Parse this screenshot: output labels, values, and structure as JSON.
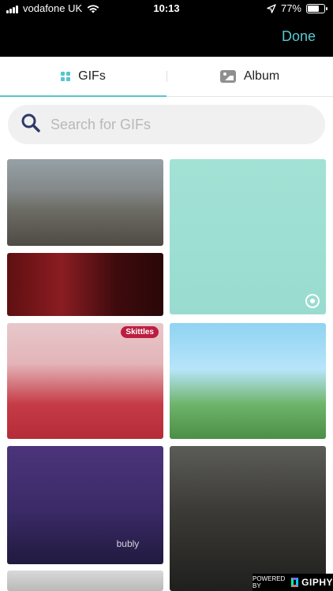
{
  "status_bar": {
    "carrier": "vodafone UK",
    "time": "10:13",
    "battery": "77%",
    "battery_level": 0.77
  },
  "header": {
    "done_label": "Done"
  },
  "tabs": [
    {
      "label": "GIFs",
      "active": true,
      "icon": "grid-icon"
    },
    {
      "label": "Album",
      "active": false,
      "icon": "photo-icon"
    }
  ],
  "search": {
    "placeholder": "Search for GIFs",
    "value": ""
  },
  "gifs": [
    {
      "id": "gif-1"
    },
    {
      "id": "gif-2"
    },
    {
      "id": "gif-3"
    },
    {
      "id": "gif-4",
      "brand": "Skittles"
    },
    {
      "id": "gif-5"
    },
    {
      "id": "gif-6",
      "brand": "bubly"
    },
    {
      "id": "gif-7"
    },
    {
      "id": "gif-8"
    }
  ],
  "footer": {
    "powered_by": "POWERED BY",
    "brand": "GIPHY"
  },
  "colors": {
    "accent": "#55c6cc",
    "done": "#5ac8d0",
    "top_bar": "#000000"
  }
}
